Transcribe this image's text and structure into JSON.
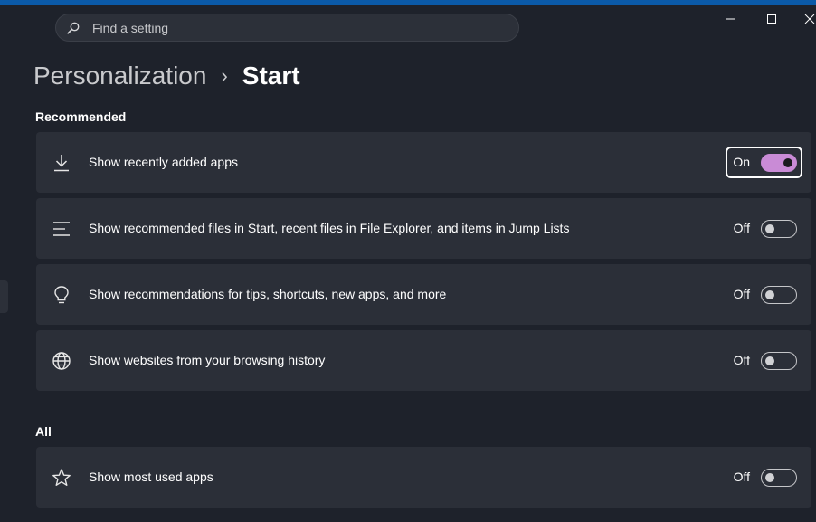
{
  "search": {
    "placeholder": "Find a setting",
    "icon": "search-icon"
  },
  "window_controls": [
    "minimize-icon",
    "maximize-icon",
    "close-icon"
  ],
  "breadcrumb": {
    "parent": "Personalization",
    "separator": "›",
    "current": "Start"
  },
  "sections": {
    "recommended": {
      "title": "Recommended"
    },
    "all": {
      "title": "All"
    }
  },
  "settings": [
    {
      "label": "Show recently added apps",
      "state": "On",
      "on": true,
      "icon": "download-icon"
    },
    {
      "label": "Show recommended files in Start, recent files in File Explorer, and items in Jump Lists",
      "state": "Off",
      "on": false,
      "icon": "list-lines-icon"
    },
    {
      "label": "Show recommendations for tips, shortcuts, new apps, and more",
      "state": "Off",
      "on": false,
      "icon": "lightbulb-icon"
    },
    {
      "label": "Show websites from your browsing history",
      "state": "Off",
      "on": false,
      "icon": "globe-icon"
    },
    {
      "label": "Show most used apps",
      "state": "Off",
      "on": false,
      "icon": "star-icon"
    }
  ],
  "colors": {
    "accent": "#c98bd6",
    "background": "#1e222b",
    "card": "#2b2f38"
  }
}
